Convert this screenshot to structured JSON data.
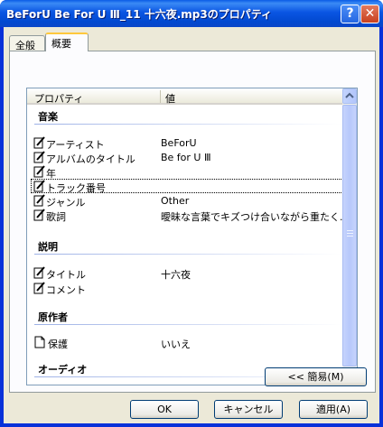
{
  "window": {
    "title": "BeForU Be For U Ⅲ_11 十六夜.mp3のプロパティ",
    "help_label": "?",
    "close_label": "✕"
  },
  "tabs": [
    {
      "label": "全般"
    },
    {
      "label": "概要"
    }
  ],
  "columns": {
    "property": "プロパティ",
    "value": "値"
  },
  "groups": {
    "music": "音楽",
    "description": "説明",
    "origin": "原作者",
    "audio": "オーディオ"
  },
  "rows": {
    "artist": {
      "property": "アーティスト",
      "value": "BeForU"
    },
    "album": {
      "property": "アルバムのタイトル",
      "value": "Be for U Ⅲ"
    },
    "year": {
      "property": "年",
      "value": ""
    },
    "track": {
      "property": "トラック番号",
      "value": ""
    },
    "genre": {
      "property": "ジャンル",
      "value": "Other"
    },
    "lyrics": {
      "property": "歌詞",
      "value": "曖昧な言葉でキズつけ合いながら重たく..."
    },
    "title": {
      "property": "タイトル",
      "value": "十六夜"
    },
    "comment": {
      "property": "コメント",
      "value": ""
    },
    "protected": {
      "property": "保護",
      "value": "いいえ"
    }
  },
  "buttons": {
    "simple": "<< 簡易(M)",
    "ok": "OK",
    "cancel": "キャンセル",
    "apply": "適用(A)"
  },
  "icons": {
    "edit": "edit-page-icon",
    "page": "page-icon"
  }
}
